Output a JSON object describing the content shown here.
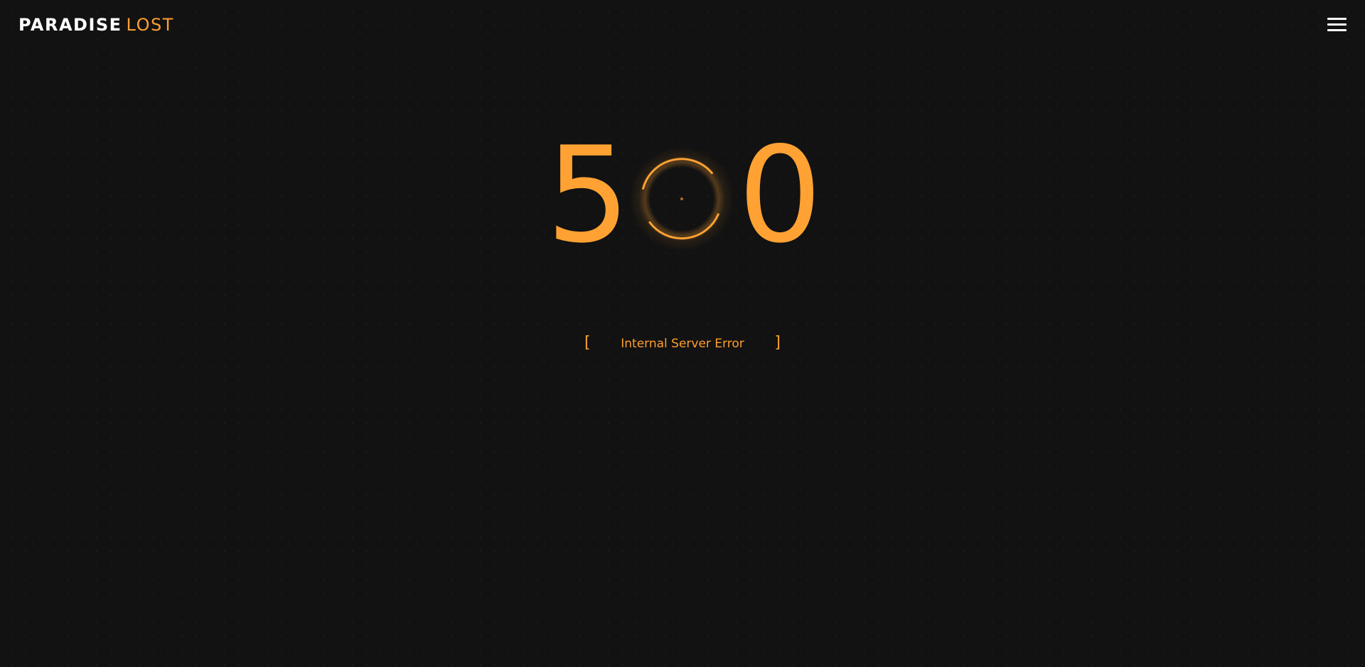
{
  "brand": {
    "name_primary": "PARADISE",
    "name_accent": "LOST"
  },
  "header": {
    "menu_icon": "hamburger-menu-icon"
  },
  "error": {
    "digit_1": "5",
    "digit_3": "0",
    "spinner_icon": "loading-ring-icon",
    "message": "Internal Server Error",
    "bracket_left": "[",
    "bracket_right": "]"
  },
  "colors": {
    "background": "#121212",
    "accent": "#ffa233",
    "logo_white": "#ffffff"
  }
}
